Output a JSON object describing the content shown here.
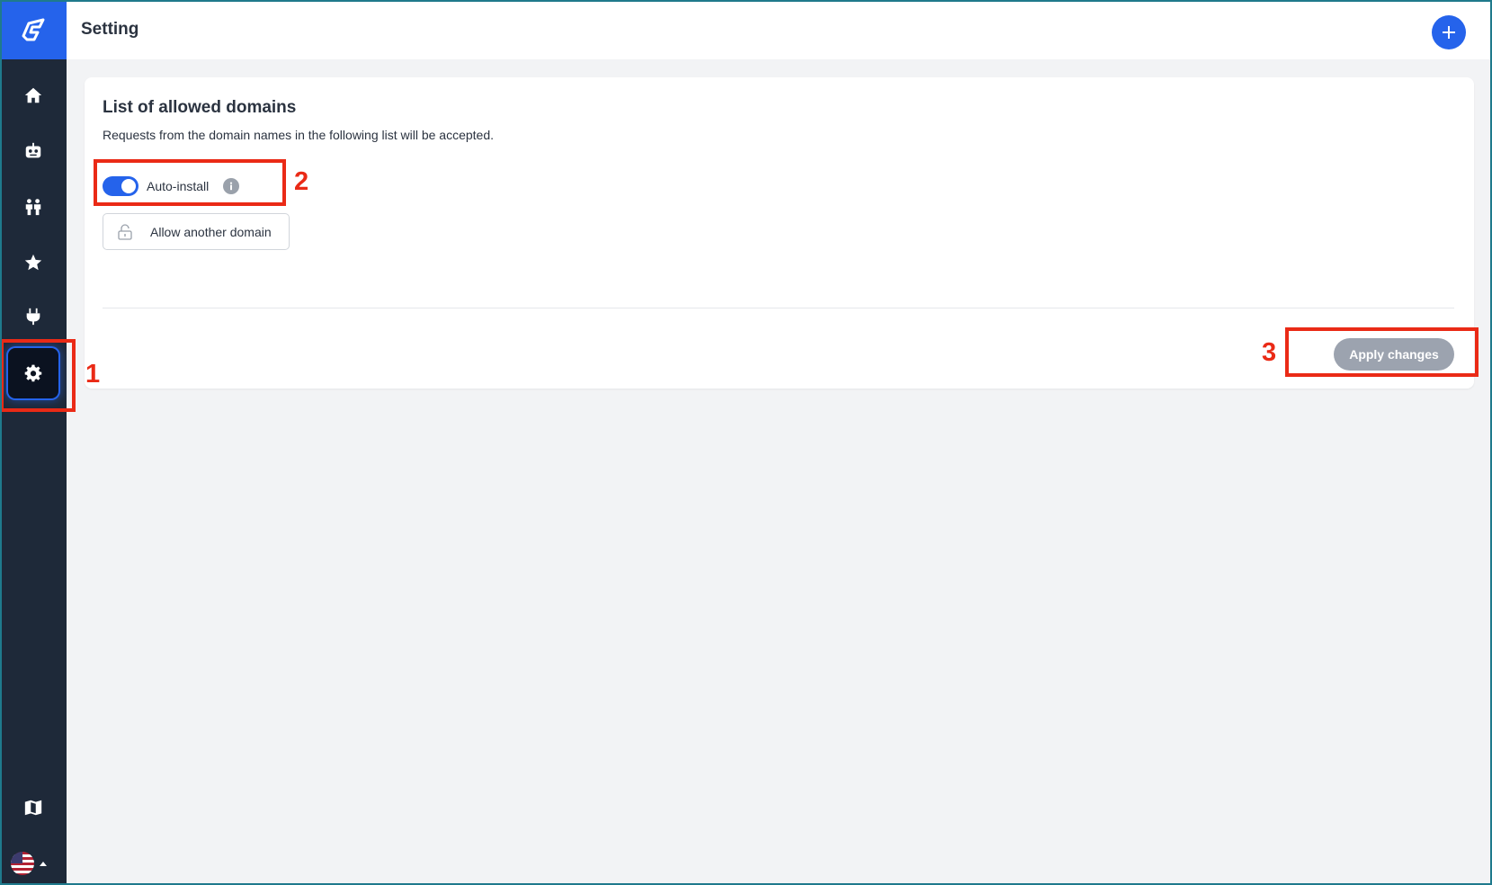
{
  "header": {
    "title": "Setting",
    "add_button_label": "+"
  },
  "sidebar": {
    "logo_icon": "logo-icon",
    "items": [
      {
        "name": "home",
        "icon": "home-icon",
        "active": false
      },
      {
        "name": "bots",
        "icon": "robot-icon",
        "active": false
      },
      {
        "name": "users",
        "icon": "users-icon",
        "active": false
      },
      {
        "name": "favorites",
        "icon": "star-icon",
        "active": false
      },
      {
        "name": "integrations",
        "icon": "plug-icon",
        "active": false
      },
      {
        "name": "settings",
        "icon": "gear-icon",
        "active": true
      }
    ],
    "bottom": {
      "docs_icon": "book-icon",
      "language_icon": "us-flag-icon"
    }
  },
  "card": {
    "title": "List of allowed domains",
    "description": "Requests from the domain names in the following list will be accepted.",
    "toggle_label": "Auto-install",
    "toggle_on": true,
    "allow_button_label": "Allow another domain",
    "apply_button_label": "Apply changes"
  },
  "annotations": [
    "1",
    "2",
    "3"
  ],
  "colors": {
    "accent": "#2563eb",
    "sidebar_bg": "#1e2939",
    "annotation": "#ea2a16",
    "disabled_button": "#9ca3af"
  }
}
